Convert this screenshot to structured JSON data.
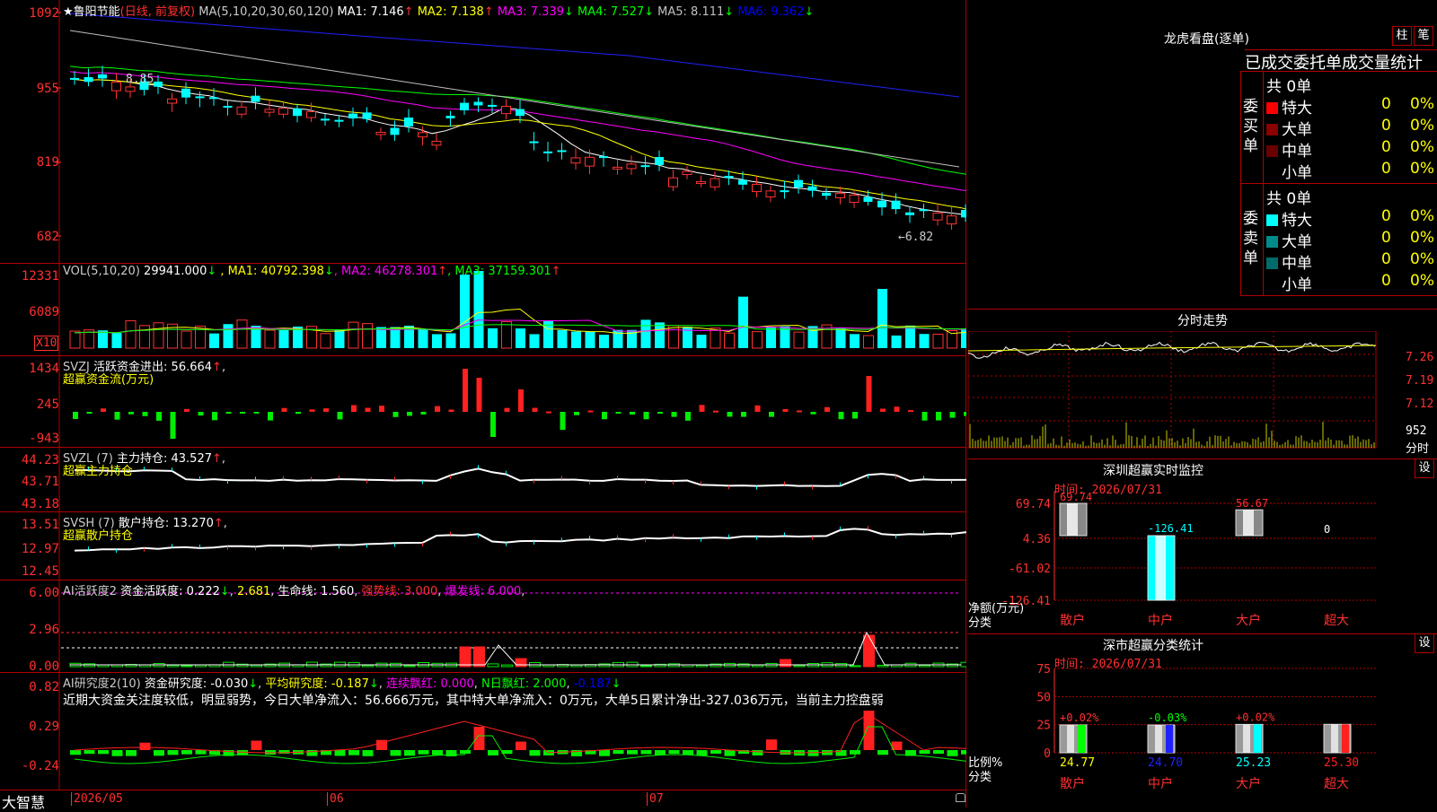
{
  "stock": {
    "name": "鲁阳节能",
    "mode": "(日线, 前复权)",
    "star": "★"
  },
  "main": {
    "ma_label": "MA(5,10,20,30,60,120)",
    "ma": [
      {
        "t": "MA1: 7.146",
        "arrow": "↑",
        "color": "#ffffff"
      },
      {
        "t": "MA2: 7.138",
        "arrow": "↑",
        "color": "#ffff00"
      },
      {
        "t": "MA3: 7.339",
        "arrow": "↓",
        "color": "#ff00ff"
      },
      {
        "t": "MA4: 7.527",
        "arrow": "↓",
        "color": "#00ff00"
      },
      {
        "t": "MA5: 8.111",
        "arrow": "↓",
        "color": "#c0c0c0"
      },
      {
        "t": "MA6: 9.362",
        "arrow": "↓",
        "color": "#0000ff"
      }
    ],
    "yticks": [
      "1092",
      "955",
      "819",
      "682"
    ],
    "high_label": "8.85",
    "low_label": "←6.82",
    "up_color": "#ff3232",
    "down_color": "#00ffff"
  },
  "vol": {
    "title": "VOL(5,10,20)",
    "value": "29941.000",
    "arrow": "↓",
    "ma": [
      {
        "t": "MA1: 40792.398",
        "arrow": "↓",
        "color": "#ffff00"
      },
      {
        "t": "MA2: 46278.301",
        "arrow": "↑",
        "color": "#ff00ff"
      },
      {
        "t": "MA3: 37159.301",
        "arrow": "↑",
        "color": "#00ff00"
      }
    ],
    "yticks": [
      "12331",
      "6089"
    ],
    "unit": "X10"
  },
  "svzj": {
    "title": "SVZJ",
    "line1": "活跃资金进出: 56.664",
    "arrow": "↑",
    "line2": "超赢资金流(万元)",
    "yticks": [
      "1434",
      "245",
      "-943"
    ]
  },
  "svzl": {
    "title": "SVZL (7)",
    "line1": "主力持仓: 43.527",
    "arrow": "↑",
    "line2": "超赢主力持仓",
    "yticks": [
      "44.23",
      "43.71",
      "43.18"
    ]
  },
  "svsh": {
    "title": "SVSH (7)",
    "line1": "散户持仓: 13.270",
    "arrow": "↑",
    "line2": "超赢散户持仓",
    "yticks": [
      "13.51",
      "12.97",
      "12.45"
    ]
  },
  "ai1": {
    "title": "AI活跃度2",
    "p1": "资金活跃度: 0.222",
    "a1": "↓",
    "p2": "2.681",
    "p3": "生命线: 1.560",
    "p4": "强势线: 3.000",
    "p5": "爆发线: 6.000",
    "yticks": [
      "6.00",
      "2.96",
      "0.00"
    ]
  },
  "ai2": {
    "title": "AI研究度2(10)",
    "p1": "资金研究度: -0.030",
    "a1": "↓",
    "p2": "平均研究度: -0.187",
    "a2": "↓",
    "p3": "连续飘红: 0.000",
    "p4": "N日飘红: 2.000",
    "p5": "-0.187",
    "a5": "↓",
    "comment": "近期大资金关注度较低，明显弱势，今日大单净流入：56.666万元，其中特大单净流入：0万元，大单5日累计净出-327.036万元，当前主力控盘弱",
    "yticks": [
      "0.82",
      "0.29",
      "-0.24"
    ]
  },
  "xaxis": {
    "app": "大智慧",
    "labels": [
      "2026/05",
      "06",
      "07"
    ]
  },
  "right": {
    "lhb": {
      "title": "龙虎看盘(逐单)",
      "btn1": "柱",
      "btn2": "笔",
      "subtitle": "已成交委托单成交量统计",
      "buy": {
        "side": "委买单",
        "total": "共 0单",
        "rows": [
          {
            "name": "特大",
            "v": "0",
            "p": "0%",
            "color": "#ff0000"
          },
          {
            "name": "大单",
            "v": "0",
            "p": "0%",
            "color": "#8b0000"
          },
          {
            "name": "中单",
            "v": "0",
            "p": "0%",
            "color": "#6b0000"
          },
          {
            "name": "小单",
            "v": "0",
            "p": "0%",
            "color": "#000000"
          }
        ]
      },
      "sell": {
        "side": "委卖单",
        "total": "共 0单",
        "rows": [
          {
            "name": "特大",
            "v": "0",
            "p": "0%",
            "color": "#00ffff"
          },
          {
            "name": "大单",
            "v": "0",
            "p": "0%",
            "color": "#008b8b"
          },
          {
            "name": "中单",
            "v": "0",
            "p": "0%",
            "color": "#006b6b"
          },
          {
            "name": "小单",
            "v": "0",
            "p": "0%",
            "color": "#000000"
          }
        ]
      }
    },
    "fs": {
      "title": "分时走势",
      "yticks": [
        "7.26",
        "7.19",
        "7.12"
      ],
      "vol_label": "952",
      "unit": "分时"
    },
    "sz": {
      "title": "深圳超赢实时监控",
      "btn": "设",
      "time": "时间: 2026/07/31",
      "yticks": [
        "69.74",
        "4.36",
        "-61.02",
        "-126.41"
      ],
      "ylabel": "净额(万元)",
      "xlabel": "分类",
      "cats": [
        "散户",
        "中户",
        "大户",
        "超大"
      ],
      "values": [
        69.74,
        -126.41,
        56.67,
        0
      ],
      "vlabels": [
        "69.74",
        "-126.41",
        "56.67",
        "0"
      ]
    },
    "sc": {
      "title": "深市超赢分类统计",
      "btn": "设",
      "time": "时间: 2026/07/31",
      "yticks": [
        "75",
        "50",
        "25",
        "0"
      ],
      "ylabel": "比例%",
      "xlabel": "分类",
      "cats": [
        "散户",
        "中户",
        "大户",
        "超大"
      ],
      "values": [
        24.77,
        24.7,
        25.23,
        25.3
      ],
      "changes": [
        "+0.02%",
        "-0.03%",
        "+0.02%",
        ""
      ]
    }
  },
  "chart_data": [
    {
      "type": "candlestick",
      "title": "鲁阳节能 (日线, 前复权)",
      "yticks": [
        "1092",
        "955",
        "819",
        "682"
      ],
      "low": "6.82",
      "high": "8.85"
    },
    {
      "type": "bar",
      "title": "VOL(5,10,20)",
      "value": 29941.0,
      "ma": [
        40792.398,
        46278.301,
        37159.301
      ]
    },
    {
      "type": "bar",
      "title": "SVZJ 活跃资金进出",
      "value": 56.664
    },
    {
      "type": "line",
      "title": "SVZL (7) 主力持仓",
      "value": 43.527
    },
    {
      "type": "line",
      "title": "SVSH (7) 散户持仓",
      "value": 13.27
    },
    {
      "type": "bar",
      "title": "AI活跃度2",
      "value": 0.222,
      "lines": {
        "生命线": 1.56,
        "强势线": 3.0,
        "爆发线": 6.0
      }
    },
    {
      "type": "bar",
      "title": "AI研究度2(10)",
      "value": -0.03,
      "avg": -0.187
    },
    {
      "type": "bar",
      "title": "深圳超赢实时监控",
      "categories": [
        "散户",
        "中户",
        "大户",
        "超大"
      ],
      "values": [
        69.74,
        -126.41,
        56.67,
        0
      ]
    },
    {
      "type": "bar",
      "title": "深市超赢分类统计",
      "categories": [
        "散户",
        "中户",
        "大户",
        "超大"
      ],
      "values": [
        24.77,
        24.7,
        25.23,
        25.3
      ]
    }
  ]
}
